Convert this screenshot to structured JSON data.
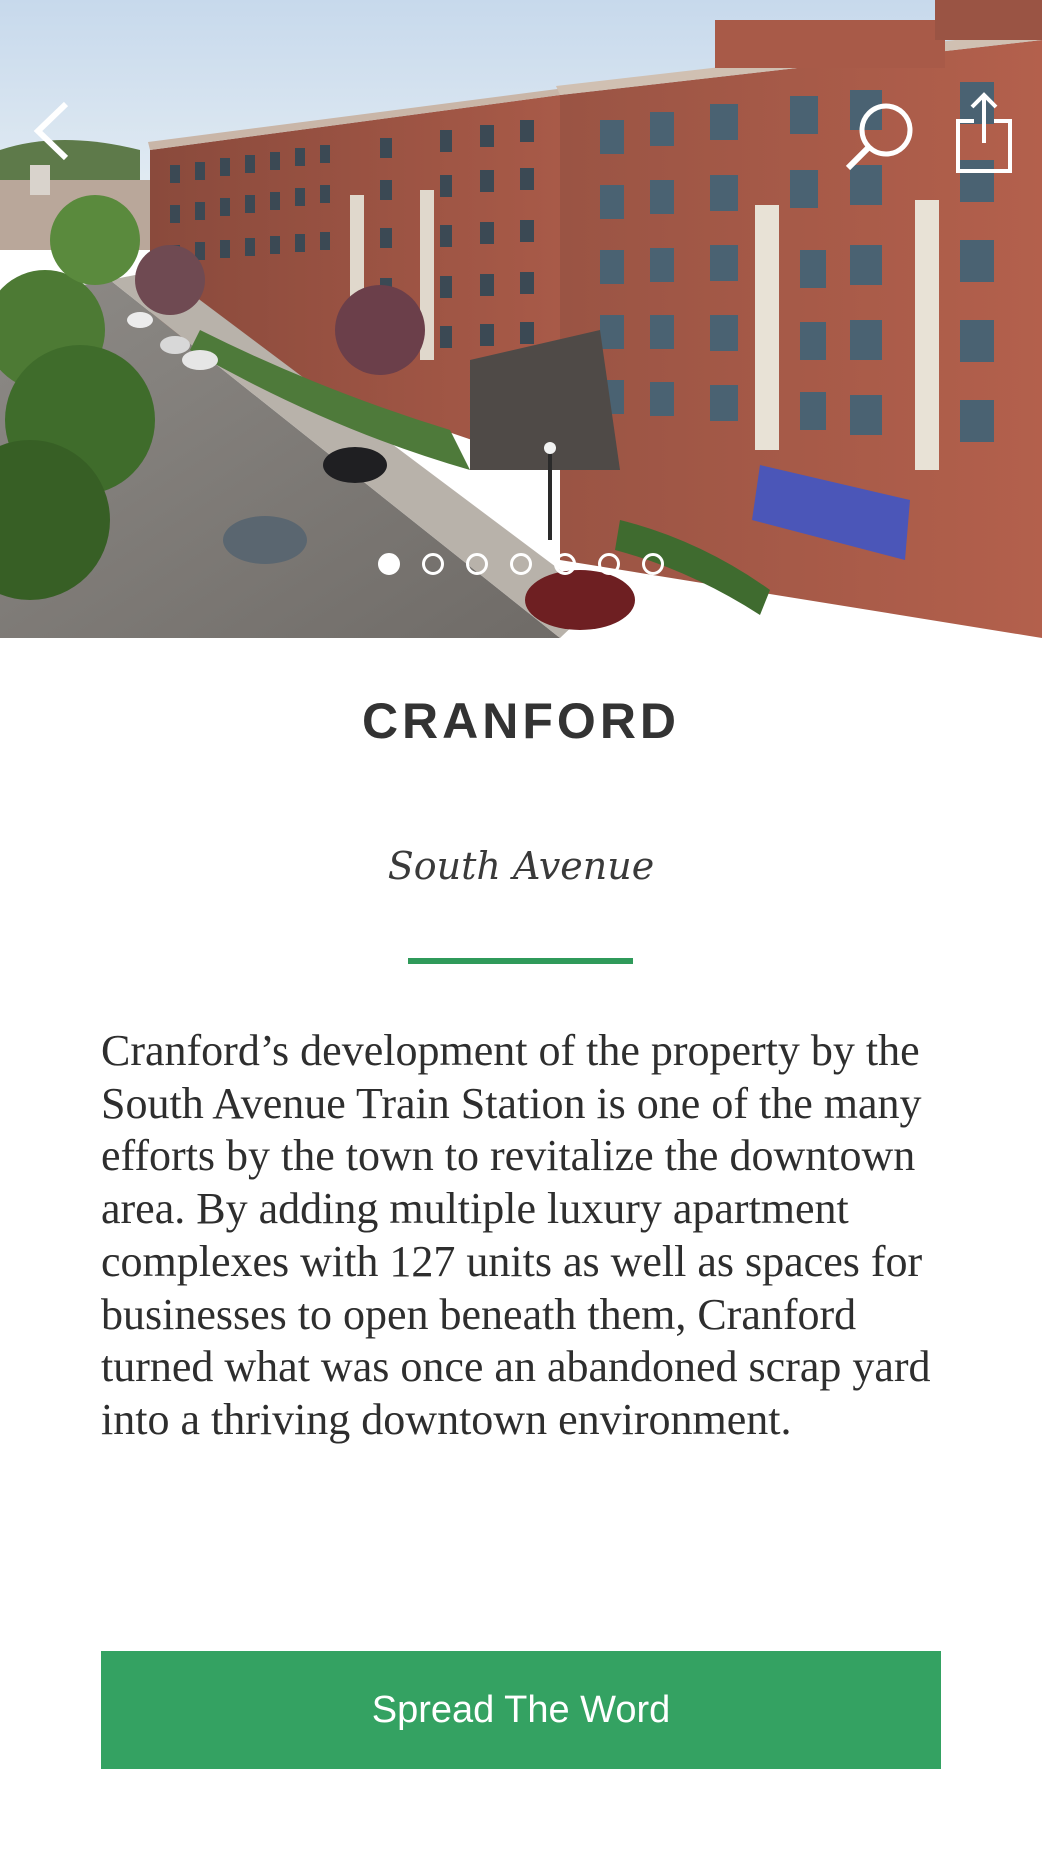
{
  "hero": {
    "image_alt": "Brick apartment buildings along South Avenue",
    "carousel": {
      "count": 7,
      "active_index": 0
    }
  },
  "nav": {
    "back_icon": "chevron-left-icon",
    "search_icon": "search-icon",
    "share_icon": "share-icon"
  },
  "content": {
    "title": "CRANFORD",
    "subtitle": "South Avenue",
    "body": "Cranford’s development of the property by the South Avenue Train Station is one of the many efforts by the town to revitalize the downtown area. By adding multiple luxury apartment complexes with 127 units as well as spaces for businesses to open beneath them, Cranford turned what was once an abandoned scrap yard into a thriving downtown environment."
  },
  "cta": {
    "label": "Spread The Word"
  },
  "colors": {
    "accent": "#34a262",
    "divider": "#2f9a5a",
    "title": "#333333",
    "text": "#2e2e2e"
  }
}
